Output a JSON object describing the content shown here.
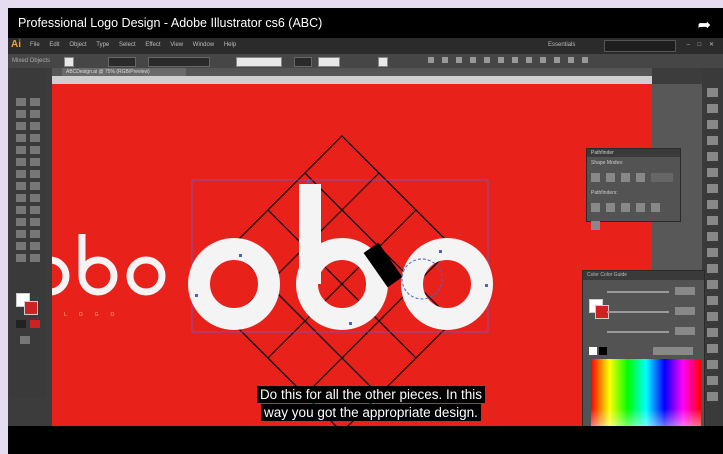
{
  "player": {
    "title": "Professional Logo Design - Adobe Illustrator cs6 (ABC)",
    "share_icon": "share-arrow-icon"
  },
  "illustrator": {
    "app_icon": "Ai",
    "menu": [
      "File",
      "Edit",
      "Object",
      "Type",
      "Select",
      "Effect",
      "View",
      "Window",
      "Help"
    ],
    "workspace": "Essentials",
    "control_bar_label": "Mixed Objects",
    "doc_tab": "ABCDesign.ai @ 75% (RGB/Preview)",
    "pathfinder": {
      "title": "Pathfinder",
      "shape_modes": "Shape Modes:",
      "pathfinders": "Pathfinders:"
    },
    "color_panel": {
      "tabs": "Color  Color Guide"
    },
    "colors": {
      "canvas": "#e8221b",
      "ui_dark": "#3c3c3c"
    }
  },
  "artwork": {
    "small_logo": "abc",
    "small_tagline": "LOGO"
  },
  "caption": {
    "line1": "Do this for all the other pieces. In this",
    "line2": "way you got the appropriate design."
  }
}
